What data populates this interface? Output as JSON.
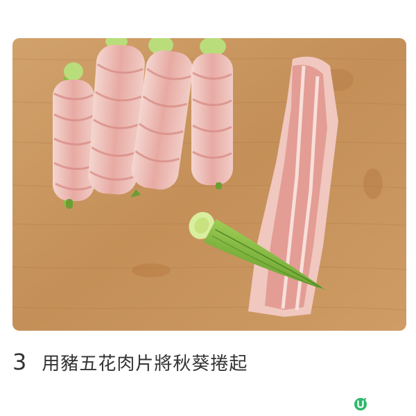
{
  "step": {
    "number": "3",
    "text": "用豬五花肉片將秋葵捲起"
  },
  "photo": {
    "subject": "pork-belly-okra-rolls-on-cutting-board"
  },
  "brand": {
    "logo_letter": "U",
    "logo_color": "#2fb86a"
  },
  "colors": {
    "board": "#c9975f",
    "pork": "#e8b8b0",
    "okra": "#7fb23a"
  }
}
